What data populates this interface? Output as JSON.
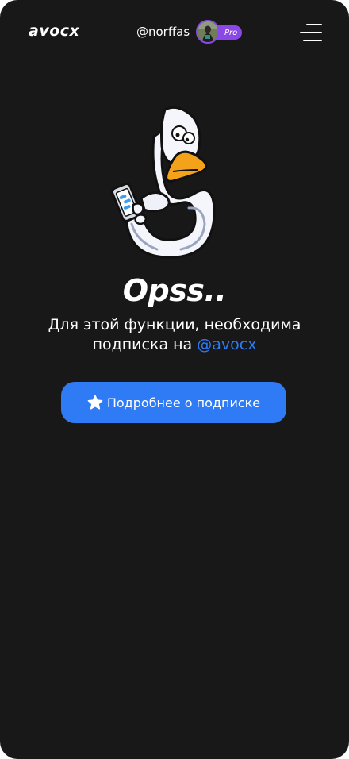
{
  "header": {
    "logo_text": "avocx",
    "username": "@norffas",
    "badge": "Pro",
    "avatar_icon": "user-avatar",
    "menu_icon": "hamburger-menu-icon"
  },
  "main": {
    "illustration": "duck-holding-phone",
    "title": "Opss..",
    "message_line1": "Для этой функции, необходима",
    "message_line2_prefix": "подписка на ",
    "message_handle": "@avocx",
    "cta_label": "Подробнее о подписке",
    "cta_icon": "star-icon"
  },
  "colors": {
    "background": "#181818",
    "accent_blue": "#2f7bf5",
    "pro_purple": "#8b48e8",
    "text": "#ffffff"
  }
}
